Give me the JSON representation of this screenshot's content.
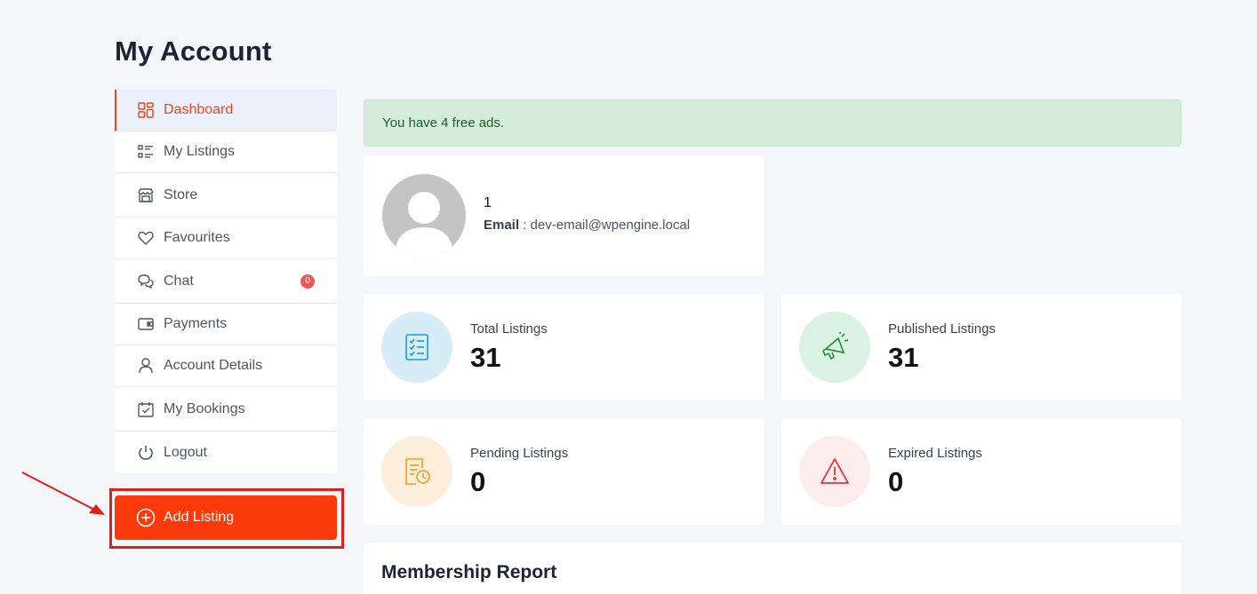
{
  "page": {
    "title": "My Account"
  },
  "sidebar": {
    "items": [
      {
        "label": "Dashboard",
        "icon": "dashboard-icon"
      },
      {
        "label": "My Listings",
        "icon": "list-icon"
      },
      {
        "label": "Store",
        "icon": "store-icon"
      },
      {
        "label": "Favourites",
        "icon": "heart-icon"
      },
      {
        "label": "Chat",
        "icon": "chat-icon",
        "badge": "0"
      },
      {
        "label": "Payments",
        "icon": "wallet-icon"
      },
      {
        "label": "Account Details",
        "icon": "user-icon"
      },
      {
        "label": "My Bookings",
        "icon": "calendar-check-icon"
      },
      {
        "label": "Logout",
        "icon": "power-icon"
      }
    ],
    "add_listing": "Add Listing"
  },
  "alert": {
    "text": "You have 4 free ads."
  },
  "profile": {
    "name": "1",
    "email_label": "Email",
    "email_sep": " : ",
    "email": "dev-email@wpengine.local"
  },
  "stats": [
    {
      "label": "Total Listings",
      "value": "31",
      "icon": "checklist-icon",
      "color": "#1a9bd7",
      "bg": "#d6ecf7"
    },
    {
      "label": "Published Listings",
      "value": "31",
      "icon": "megaphone-icon",
      "color": "#1f8a3a",
      "bg": "#daf2e2"
    },
    {
      "label": "Pending Listings",
      "value": "0",
      "icon": "document-clock-icon",
      "color": "#f39c1d",
      "bg": "#fdeedb"
    },
    {
      "label": "Expired Listings",
      "value": "0",
      "icon": "warning-icon",
      "color": "#e0333a",
      "bg": "#fdecec"
    }
  ],
  "membership": {
    "title": "Membership Report"
  },
  "colors": {
    "accent": "#f0441e",
    "button": "#fb3a0c",
    "highlight": "#e11d1d"
  }
}
